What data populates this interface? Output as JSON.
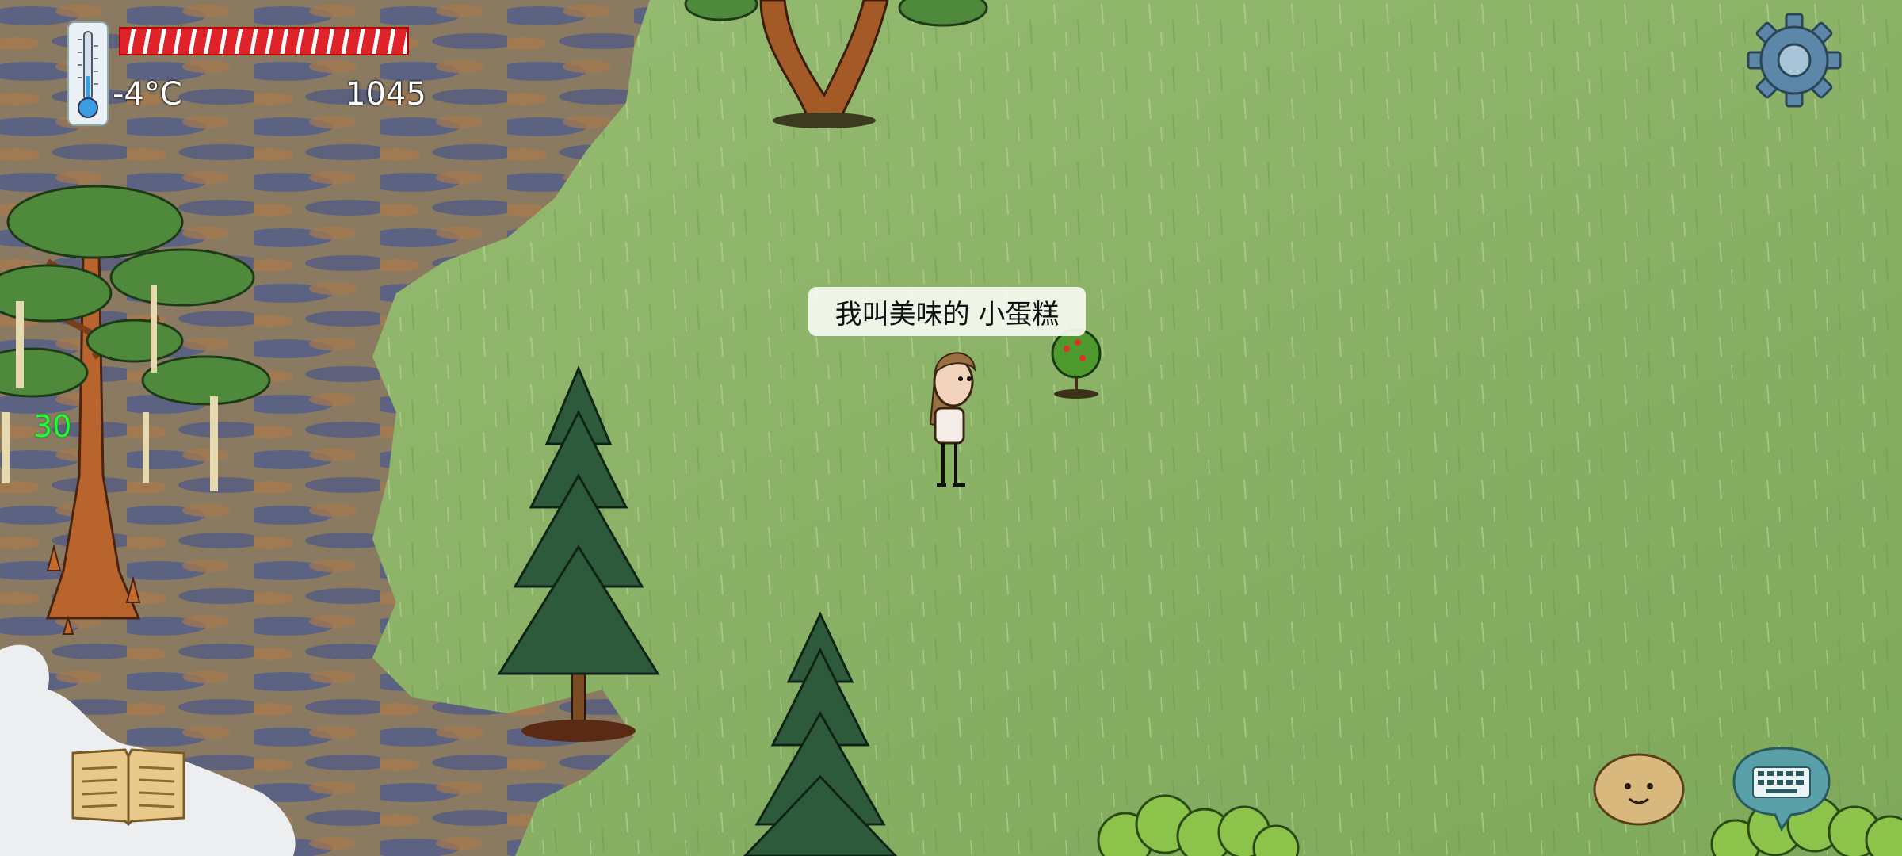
{
  "hud": {
    "temperature": "-4°C",
    "score": "1045",
    "age": "30",
    "health_fraction": 1.0
  },
  "player": {
    "speech": "我叫美味的 小蛋糕"
  },
  "buttons": {
    "settings_icon": "gear-icon",
    "book_icon": "book-icon",
    "emote_icon": "smiley-face-icon",
    "keyboard_icon": "keyboard-icon"
  },
  "colors": {
    "grass": "#8db26a",
    "swamp": "#6a6a74",
    "health": "#e0232b",
    "age_text": "#1cff2a"
  }
}
